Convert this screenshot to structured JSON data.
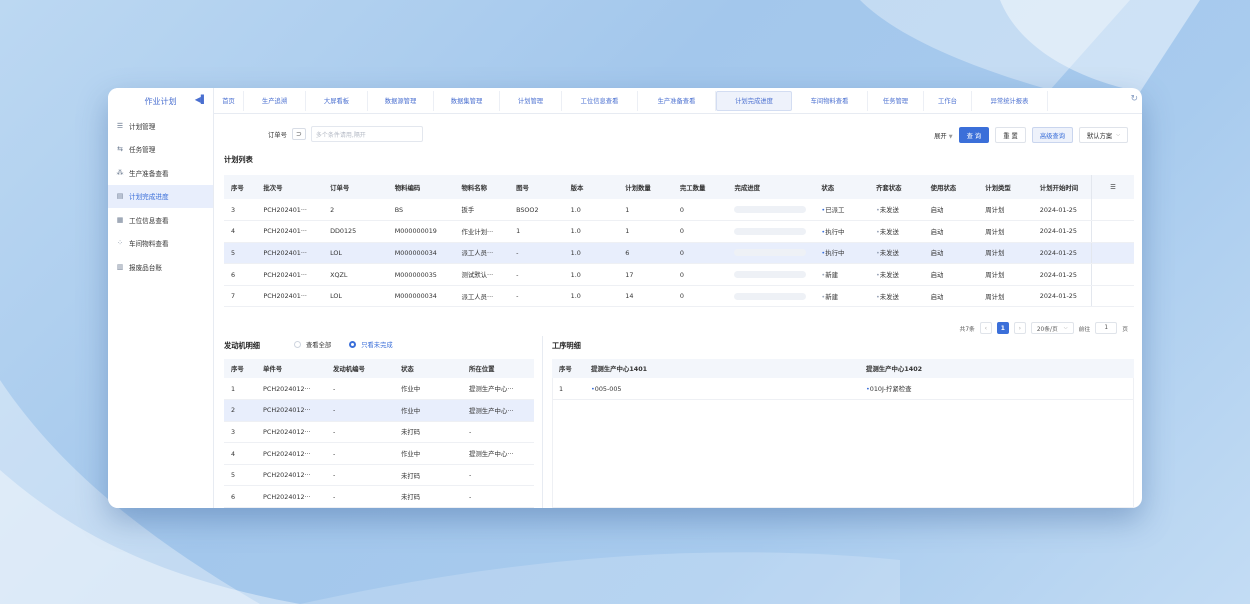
{
  "sidebar": {
    "title": "作业计划",
    "items": [
      {
        "label": "计划管理",
        "icon": "list-icon"
      },
      {
        "label": "任务管理",
        "icon": "task-icon"
      },
      {
        "label": "生产准备查看",
        "icon": "org-icon"
      },
      {
        "label": "计划完成进度",
        "icon": "progress-icon"
      },
      {
        "label": "工位信息查看",
        "icon": "station-icon"
      },
      {
        "label": "车间物料查看",
        "icon": "material-icon"
      },
      {
        "label": "报废品台账",
        "icon": "ledger-icon"
      }
    ],
    "active_index": 3
  },
  "tabs": [
    "首页",
    "生产追溯",
    "大屏看板",
    "数据源管理",
    "数据集管理",
    "计划管理",
    "工位信息查看",
    "生产准备查看",
    "计划完成进度",
    "车间物料查看",
    "任务管理",
    "工作台",
    "异常统计报表"
  ],
  "active_tab": 8,
  "filter": {
    "label": "订单号",
    "placeholder": "多个条件请用,隔开"
  },
  "actions": {
    "expand": "展开",
    "search": "查 询",
    "reset": "重 置",
    "advanced": "高级查询",
    "scheme": "默认方案"
  },
  "plan_list": {
    "title": "计划列表",
    "columns": [
      "序号",
      "批次号",
      "订单号",
      "物料编码",
      "物料名称",
      "图号",
      "版本",
      "计划数量",
      "完工数量",
      "完成进度",
      "状态",
      "齐套状态",
      "使用状态",
      "计划类型",
      "计划开始时间"
    ],
    "rows": [
      [
        "3",
        "PCH202401···",
        "2",
        "BS",
        "扳手",
        "BSOO2",
        "1.0",
        "1",
        "0",
        "0%",
        "已派工",
        "未发送",
        "启动",
        "周计划",
        "2024-01-25"
      ],
      [
        "4",
        "PCH202401···",
        "DD0125",
        "M000000019",
        "作业计划···",
        "1",
        "1.0",
        "1",
        "0",
        "0%",
        "执行中",
        "未发送",
        "启动",
        "周计划",
        "2024-01-25"
      ],
      [
        "5",
        "PCH202401···",
        "LOL",
        "M000000034",
        "派工人员···",
        "-",
        "1.0",
        "6",
        "0",
        "0%",
        "执行中",
        "未发送",
        "启动",
        "周计划",
        "2024-01-25"
      ],
      [
        "6",
        "PCH202401···",
        "XQZL",
        "M000000035",
        "测试默认···",
        "-",
        "1.0",
        "17",
        "0",
        "0%",
        "新建",
        "未发送",
        "启动",
        "周计划",
        "2024-01-25"
      ],
      [
        "7",
        "PCH202401···",
        "LOL",
        "M000000034",
        "派工人员···",
        "-",
        "1.0",
        "14",
        "0",
        "0%",
        "新建",
        "未发送",
        "启动",
        "周计划",
        "2024-01-25"
      ]
    ],
    "selected_row": 2
  },
  "pager": {
    "total": "共7条",
    "page": "1",
    "size": "20条/页",
    "goto_label": "前往",
    "goto_value": "1",
    "page_unit": "页"
  },
  "engine": {
    "title": "发动机明细",
    "radio_all": "查看全部",
    "radio_unfinished": "只看未完成",
    "columns": [
      "序号",
      "单件号",
      "发动机编号",
      "状态",
      "所在位置"
    ],
    "rows": [
      [
        "1",
        "PCH2024012···",
        "-",
        "作业中",
        "提测生产中心···"
      ],
      [
        "2",
        "PCH2024012···",
        "-",
        "作业中",
        "提测生产中心···"
      ],
      [
        "3",
        "PCH2024012···",
        "-",
        "未打码",
        "-"
      ],
      [
        "4",
        "PCH2024012···",
        "-",
        "作业中",
        "提测生产中心···"
      ],
      [
        "5",
        "PCH2024012···",
        "-",
        "未打码",
        "-"
      ],
      [
        "6",
        "PCH2024012···",
        "-",
        "未打码",
        "-"
      ]
    ],
    "selected_row": 1
  },
  "process": {
    "title": "工序明细",
    "columns": [
      "序号",
      "提测生产中心1401",
      "提测生产中心1402"
    ],
    "rows": [
      [
        "1",
        "005-005",
        "010J-拧紧检查"
      ]
    ]
  },
  "colors": {
    "accent": "#3b6fd9",
    "selected_row": "#e8eefc"
  }
}
